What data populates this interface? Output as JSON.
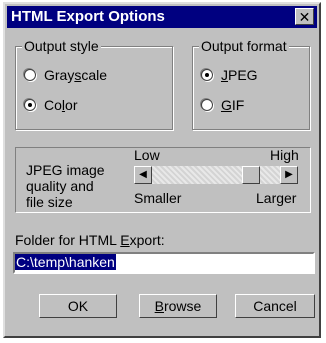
{
  "dialog": {
    "title": "HTML Export Options",
    "close_label": "✕"
  },
  "output_style": {
    "legend": "Output style",
    "options": [
      {
        "label_pre": "Gray",
        "label_u": "s",
        "label_post": "cale",
        "selected": false
      },
      {
        "label_pre": "Co",
        "label_u": "l",
        "label_post": "or",
        "selected": true
      }
    ]
  },
  "output_format": {
    "legend": "Output format",
    "options": [
      {
        "label_pre": "",
        "label_u": "J",
        "label_post": "PEG",
        "selected": true
      },
      {
        "label_pre": "",
        "label_u": "G",
        "label_post": "IF",
        "selected": false
      }
    ]
  },
  "quality": {
    "label_line1": "JPEG image",
    "label_line2": "quality and",
    "label_line3": "file size",
    "low_label": "Low",
    "high_label": "High",
    "smaller_label": "Smaller",
    "larger_label": "Larger",
    "level_fraction": 0.82
  },
  "folder": {
    "label_pre": "Folder for HTML ",
    "label_u": "E",
    "label_post": "xport:",
    "value": "C:\\temp\\hanken"
  },
  "buttons": {
    "ok": "OK",
    "browse_u": "B",
    "browse_rest": "rowse",
    "cancel": "Cancel"
  }
}
